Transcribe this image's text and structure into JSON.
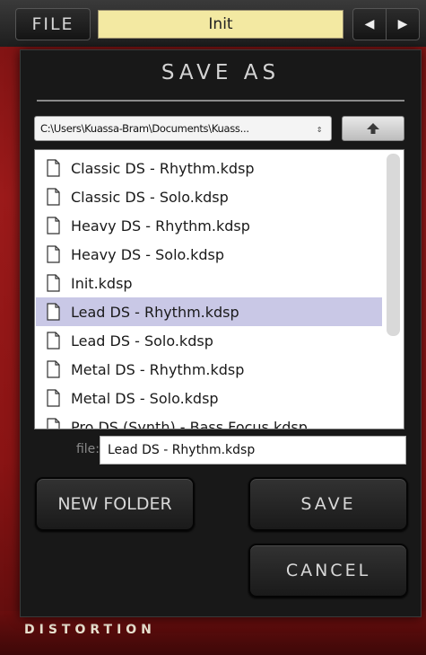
{
  "header": {
    "file_button": "FILE",
    "preset_name": "Init",
    "prev_icon": "triangle-left",
    "next_icon": "triangle-right"
  },
  "dialog": {
    "title": "SAVE AS",
    "path": "C:\\Users\\Kuassa-Bram\\Documents\\Kuass...",
    "up_icon": "up-arrow-icon",
    "files": [
      {
        "name": "Classic DS - Rhythm.kdsp",
        "selected": false
      },
      {
        "name": "Classic DS - Solo.kdsp",
        "selected": false
      },
      {
        "name": "Heavy DS - Rhythm.kdsp",
        "selected": false
      },
      {
        "name": "Heavy DS - Solo.kdsp",
        "selected": false
      },
      {
        "name": "Init.kdsp",
        "selected": false
      },
      {
        "name": "Lead DS - Rhythm.kdsp",
        "selected": true
      },
      {
        "name": "Lead DS - Solo.kdsp",
        "selected": false
      },
      {
        "name": "Metal DS - Rhythm.kdsp",
        "selected": false
      },
      {
        "name": "Metal DS - Solo.kdsp",
        "selected": false
      },
      {
        "name": "Pro DS (Synth) - Bass Focus.kdsp",
        "selected": false
      }
    ],
    "file_label": "file:",
    "file_value": "Lead DS - Rhythm.kdsp",
    "new_folder_label": "NEW FOLDER",
    "save_label": "SAVE",
    "cancel_label": "CANCEL"
  },
  "footer": {
    "brand_text": "DISTORTION"
  },
  "colors": {
    "selection": "#c9c8e6",
    "preset_bg": "#f3e9a2",
    "plugin_red": "#9b1a1a"
  }
}
